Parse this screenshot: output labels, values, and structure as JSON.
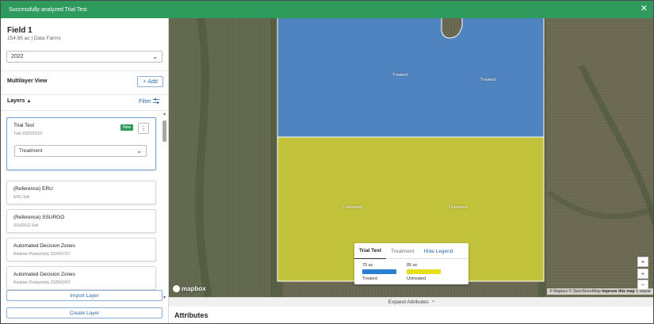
{
  "toast": {
    "message": "Successfully analyzed Trial Test",
    "close_label": "✕"
  },
  "field": {
    "title": "Field 1",
    "subtitle": "154.85 ac | Data Farms",
    "year": "2022"
  },
  "multilayer": {
    "label": "Multilayer View",
    "add_label": "Add"
  },
  "layers": {
    "label": "Layers",
    "filter_label": "Filter"
  },
  "layer_cards": [
    {
      "title": "Trial Test",
      "subtitle": "Trial   2025/03/10",
      "badge": "New",
      "select_value": "Treatment"
    },
    {
      "title": "(Reference) ERU",
      "subtitle": "ERU Soil"
    },
    {
      "title": "(Reference) SSURGO",
      "subtitle": "SSURGO Soil"
    },
    {
      "title": "Automated Decision Zones",
      "subtitle": "Relative Productivity   2024/07/17"
    },
    {
      "title": "Automated Decision Zones",
      "subtitle": "Relative Productivity   2025/02/07"
    }
  ],
  "buttons": {
    "import_layer": "Import Layer",
    "create_layer": "Create Layer"
  },
  "map": {
    "plot_labels": {
      "treated_1": "Treated",
      "treated_2": "Treated",
      "untreated_1": "Untreated",
      "untreated_2": "Untreated"
    },
    "legend": {
      "tabs": [
        "Trial Test",
        "Treatment",
        "Hide Legend"
      ],
      "items": [
        {
          "acres": "70 ac",
          "name": "Treated",
          "color": "#2a7fd0"
        },
        {
          "acres": "85 ac",
          "name": "Untreated",
          "color": "#e6e01a"
        }
      ]
    },
    "logo": "mapbox",
    "attribution": {
      "text": "© Mapbox © OpenStreetMap",
      "improve": "Improve this map",
      "maxar": "© Maxar"
    },
    "controls": [
      "locate-icon",
      "zoom-in-icon",
      "zoom-out-icon"
    ]
  },
  "expand_attributes": "Expand Attributes",
  "attributes_title": "Attributes",
  "colors": {
    "toast": "#2e9a5c",
    "accent": "#2b6cb0",
    "treated": "#4f86c6",
    "untreated": "#c8c83a"
  }
}
